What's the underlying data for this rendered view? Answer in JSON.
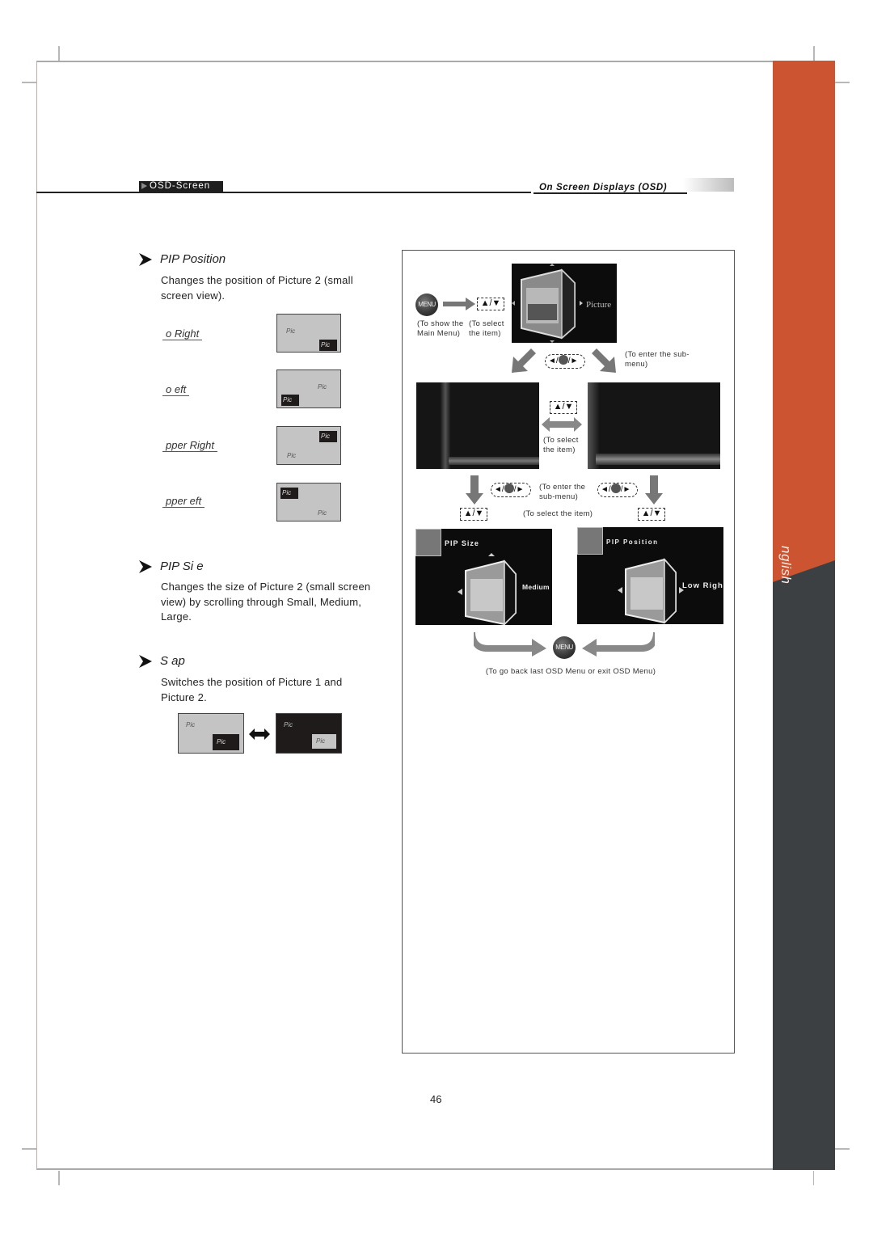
{
  "header": {
    "section_tag": "OSD-Screen",
    "chapter_title": "On Screen Displays (OSD)"
  },
  "side_tab": {
    "language": "nglish",
    "colors": {
      "accent": "#cc5431",
      "dark": "#3d4043"
    }
  },
  "sections": [
    {
      "title": "PIP Position",
      "description": "Changes the position of Picture 2 (small screen view).",
      "options": [
        {
          "label": "o   Right",
          "pip_corner": "bottom-right"
        },
        {
          "label": "o     eft",
          "pip_corner": "bottom-left"
        },
        {
          "label": "pper Right",
          "pip_corner": "top-right"
        },
        {
          "label": "pper   eft",
          "pip_corner": "top-left"
        }
      ]
    },
    {
      "title": "PIP Si  e",
      "description": "Changes the size of Picture 2 (small screen view) by scrolling through Small, Medium, Large."
    },
    {
      "title": "S   ap",
      "description": "Switches the position of Picture 1 and Picture 2."
    }
  ],
  "pip_label": "Pic",
  "diagram": {
    "menu_button": "MENU",
    "updown_glyph": "▲/▼",
    "notes": {
      "show_main_menu": "(To show the Main Menu)",
      "select_item": "(To select the item)",
      "enter_submenu": "(To enter the sub-menu)",
      "select_item_middle": "(To select the item)",
      "enter_submenu_middle": "(To enter the sub-menu)",
      "select_item_bottom": "(To select the item)",
      "go_back": "(To go back last OSD Menu or exit OSD Menu)"
    },
    "osd_main_label": "Picture",
    "osd_size_title": "PIP Size",
    "osd_size_value": "Medium",
    "osd_position_title": "PIP Position",
    "osd_position_value": "Low Righ"
  },
  "page_number": "46"
}
